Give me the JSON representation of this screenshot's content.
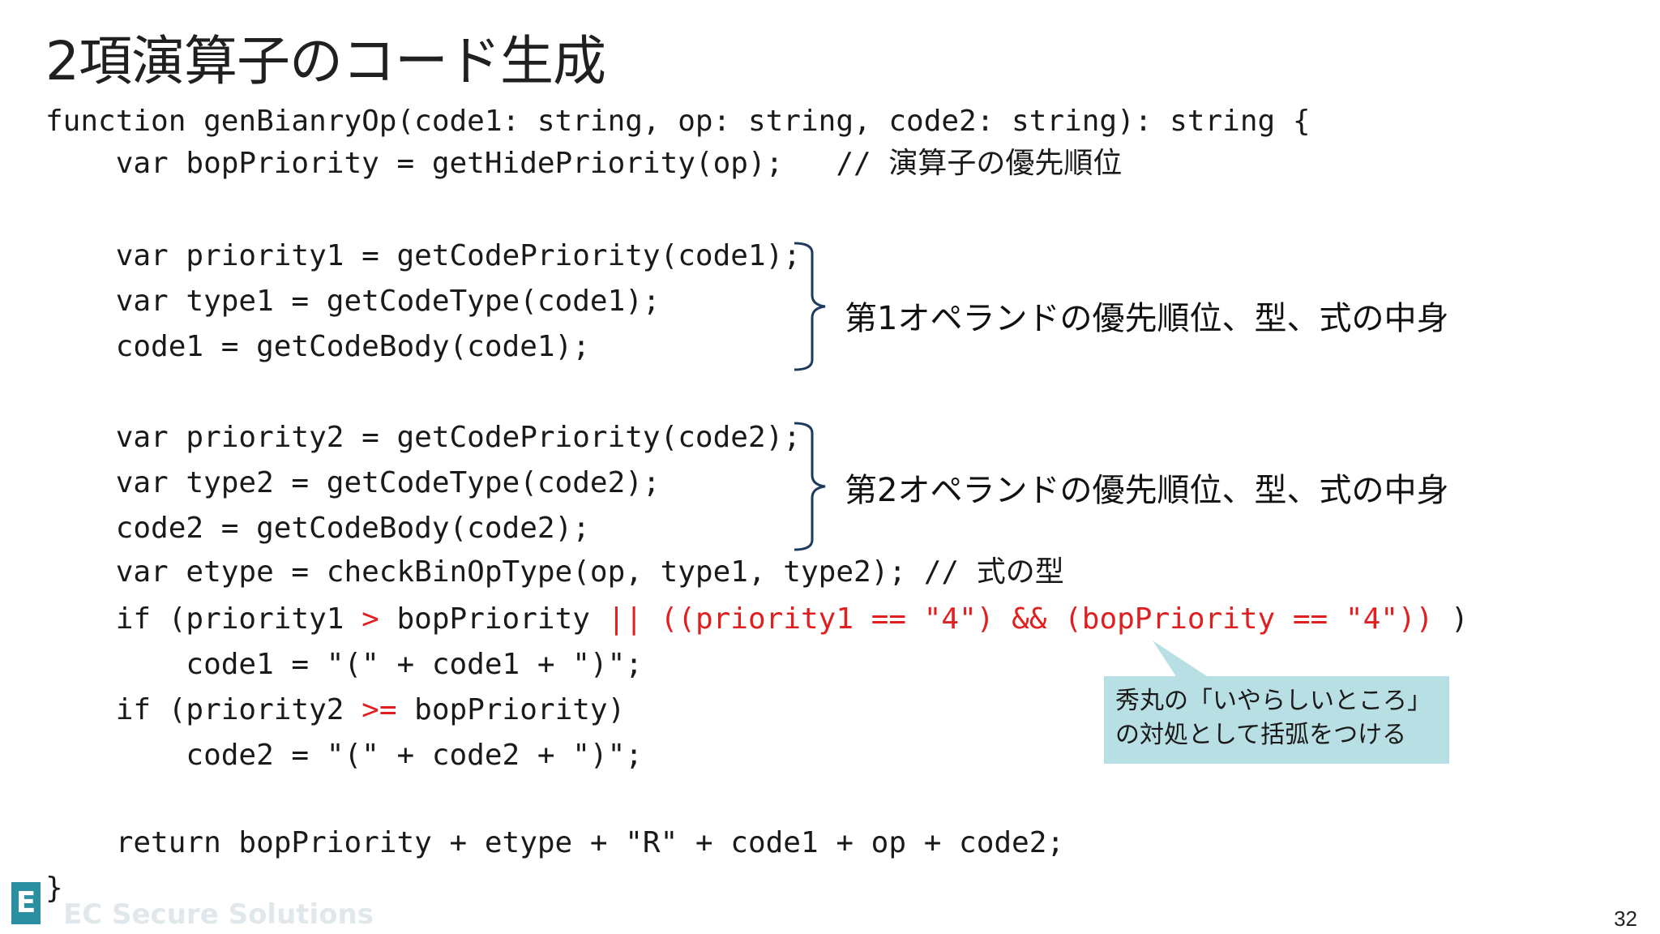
{
  "slide": {
    "title": "2項演算子のコード生成",
    "page_number": "32"
  },
  "code": {
    "line1": "function genBianryOp(code1: string, op: string, code2: string): string {",
    "line2": "    var bopPriority = getHidePriority(op);   // 演算子の優先順位",
    "line3": "    var priority1 = getCodePriority(code1);",
    "line4": "    var type1 = getCodeType(code1);",
    "line5": "    code1 = getCodeBody(code1);",
    "line6": "    var priority2 = getCodePriority(code2);",
    "line7": "    var type2 = getCodeType(code2);",
    "line8": "    code2 = getCodeBody(code2);",
    "line9": "    var etype = checkBinOpType(op, type1, type2); // 式の型",
    "line10_a": "    if (priority1 ",
    "line10_b": ">",
    "line10_c": " bopPriority ",
    "line10_d": "|| ((priority1 == \"4\") && (bopPriority == \"4\"))",
    "line10_e": " )",
    "line11": "        code1 = \"(\" + code1 + \")\";",
    "line12_a": "    if (priority2 ",
    "line12_b": ">=",
    "line12_c": " bopPriority)",
    "line13": "        code2 = \"(\" + code2 + \")\";",
    "line14": "    return bopPriority + etype + \"R\" + code1 + op + code2;",
    "line15": "}"
  },
  "annotations": {
    "operand1": "第1オペランドの優先順位、型、式の中身",
    "operand2": "第2オペランドの優先順位、型、式の中身",
    "callout_line1": "秀丸の「いやらしいところ」",
    "callout_line2": "の対処として括弧をつける"
  },
  "logo": {
    "mark": "E",
    "text": "EC Secure Solutions"
  },
  "colors": {
    "highlight": "#e02020",
    "callout_bg": "#b8dfe3",
    "brace": "#1f3a5f"
  }
}
